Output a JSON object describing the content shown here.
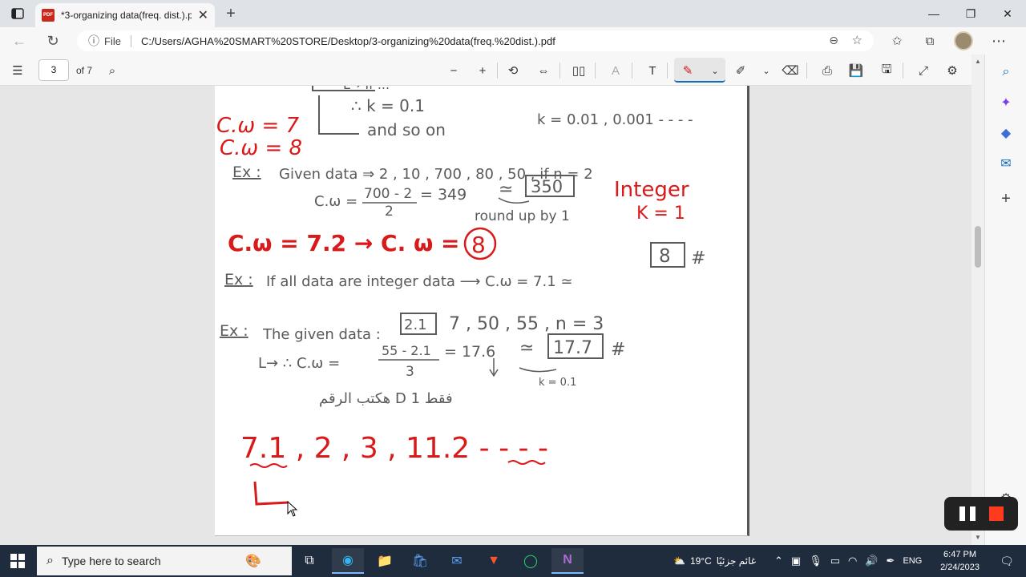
{
  "browser": {
    "tab_title": "*3-organizing data(freq. dist.).pdf",
    "tab_favicon_text": "PDF",
    "address_scheme_label": "File",
    "url": "C:/Users/AGHA%20SMART%20STORE/Desktop/3-organizing%20data(freq.%20dist.).pdf"
  },
  "pdf_toolbar": {
    "page_number": "3",
    "page_total_label": "of 7"
  },
  "page_notes": {
    "line1": "L→ If ...",
    "line2": "∴ k = 0.1",
    "line3": "and so on",
    "line3b": "k = 0.01 , 0.001 - - - -",
    "cw7": "C.ω = 7",
    "cw8": "C.ω = 8",
    "ex1_label": "Ex :",
    "ex1_text": "Given data ⇒ 2 , 10 , 700 , 80 , 50 , if n = 2",
    "ex1_calc_left": "C.ω =",
    "ex1_frac_num": "700 - 2",
    "ex1_frac_den": "2",
    "ex1_calc_right": "= 349",
    "ex1_approx": "≃",
    "ex1_boxed": "350",
    "ex1_note": "round up by 1",
    "integer_label": "Integer",
    "k1_label": "K = 1",
    "red_line": "C.ω = 7.2 → C. ω =",
    "red_circled": "8",
    "ex2_label": "Ex :",
    "ex2_text": "If all data are integer data ⟶ C.ω = 7.1 ≃",
    "ex2_boxed": "8",
    "ex2_hash": "#",
    "ex3_label": "Ex :",
    "ex3_text_a": "The given data :",
    "ex3_boxed_a": "2.1",
    "ex3_text_b": "7 , 50 , 55 , n = 3",
    "ex3_calc_left": "L→ ∴ C.ω =",
    "ex3_frac_num": "55 - 2.1",
    "ex3_frac_den": "3",
    "ex3_calc_right": "= 17.6",
    "ex3_approx": "≃",
    "ex3_boxed": "17.7",
    "ex3_hash": "#",
    "ex3_k_note": "k = 0.1",
    "arabic_note": "هكتب الرقم D 1 فقط",
    "red_bottom": "7.1 , 2 , 3 , 11.2 - - - -",
    "red_bottom_L": "L"
  },
  "taskbar": {
    "search_placeholder": "Type here to search",
    "weather": "19°C",
    "weather_desc": "غائم جزئيًا",
    "lang": "ENG",
    "time": "6:47 PM",
    "date": "2/24/2023"
  },
  "colors": {
    "ink_gray": "#5a5a5a",
    "ink_red": "#d91a1a",
    "accent": "#0f6cbd"
  }
}
